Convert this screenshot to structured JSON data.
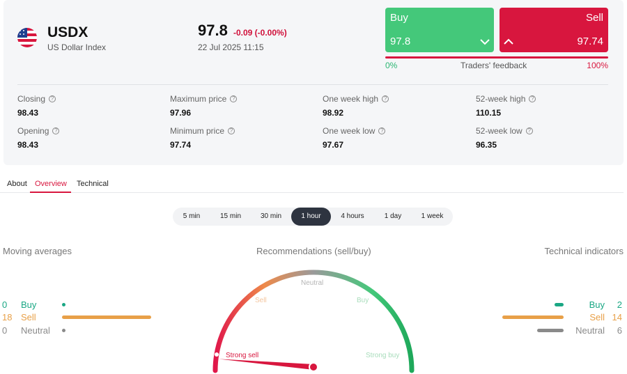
{
  "instrument": {
    "symbol": "USDX",
    "name": "US Dollar Index",
    "price": "97.8",
    "change": "-0.09 (-0.00%)",
    "datetime": "22 Jul 2025 11:15",
    "flag_icon": "us-flag-icon"
  },
  "trade": {
    "buy_label": "Buy",
    "buy_value": "97.8",
    "sell_label": "Sell",
    "sell_value": "97.74",
    "buy_color": "#44c87a",
    "sell_color": "#d8163e"
  },
  "feedback": {
    "left": "0%",
    "label": "Traders' feedback",
    "right": "100%",
    "buy_fraction": 0.0
  },
  "stats": [
    {
      "label": "Closing",
      "value": "98.43"
    },
    {
      "label": "Maximum price",
      "value": "97.96"
    },
    {
      "label": "One week high",
      "value": "98.92"
    },
    {
      "label": "52-week high",
      "value": "110.15"
    },
    {
      "label": "Opening",
      "value": "98.43"
    },
    {
      "label": "Minimum price",
      "value": "97.74"
    },
    {
      "label": "One week low",
      "value": "97.67"
    },
    {
      "label": "52-week low",
      "value": "96.35"
    }
  ],
  "tabs": [
    {
      "label": "About",
      "active": false
    },
    {
      "label": "Overview",
      "active": true
    },
    {
      "label": "Technical",
      "active": false
    }
  ],
  "timeframes": [
    {
      "label": "5 min",
      "active": false
    },
    {
      "label": "15 min",
      "active": false
    },
    {
      "label": "30 min",
      "active": false
    },
    {
      "label": "1 hour",
      "active": true
    },
    {
      "label": "4 hours",
      "active": false
    },
    {
      "label": "1 day",
      "active": false
    },
    {
      "label": "1 week",
      "active": false
    }
  ],
  "moving_averages": {
    "title": "Moving averages",
    "rows": [
      {
        "count": "0",
        "label": "Buy",
        "value": 0,
        "color": "#1aa784"
      },
      {
        "count": "18",
        "label": "Sell",
        "value": 18,
        "color": "#e8a048"
      },
      {
        "count": "0",
        "label": "Neutral",
        "value": 0,
        "color": "#8a8a8a"
      }
    ]
  },
  "recommendations": {
    "title": "Recommendations (sell/buy)",
    "labels": {
      "strong_sell": "Strong sell",
      "sell": "Sell",
      "neutral": "Neutral",
      "buy": "Buy",
      "strong_buy": "Strong buy"
    },
    "needle_value": 0.06
  },
  "technical_indicators": {
    "title": "Technical indicators",
    "rows": [
      {
        "count": "2",
        "label": "Buy",
        "value": 2,
        "color": "#1aa784"
      },
      {
        "count": "14",
        "label": "Sell",
        "value": 14,
        "color": "#e8a048"
      },
      {
        "count": "6",
        "label": "Neutral",
        "value": 6,
        "color": "#8a8a8a"
      }
    ]
  }
}
